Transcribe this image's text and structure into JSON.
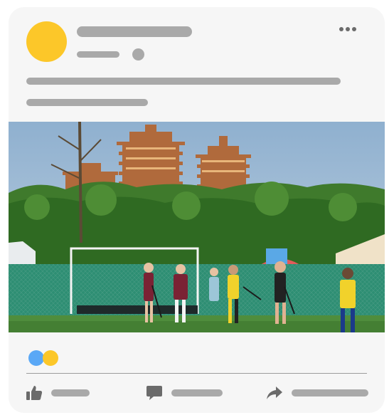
{
  "post": {
    "author_avatar_color": "#fcc729",
    "placeholder_color": "#a9a9a9",
    "photo": {
      "description_icon": "photo-field-hockey-match"
    }
  },
  "reactions": [
    {
      "type": "like",
      "color": "#5aa8f6",
      "icon": "like-reaction-icon"
    },
    {
      "type": "love",
      "color": "#fcc729",
      "icon": "reaction-icon"
    }
  ],
  "actions": [
    {
      "id": "like",
      "icon": "thumbs-up-icon"
    },
    {
      "id": "comment",
      "icon": "comment-icon"
    },
    {
      "id": "share",
      "icon": "share-arrow-icon"
    }
  ]
}
